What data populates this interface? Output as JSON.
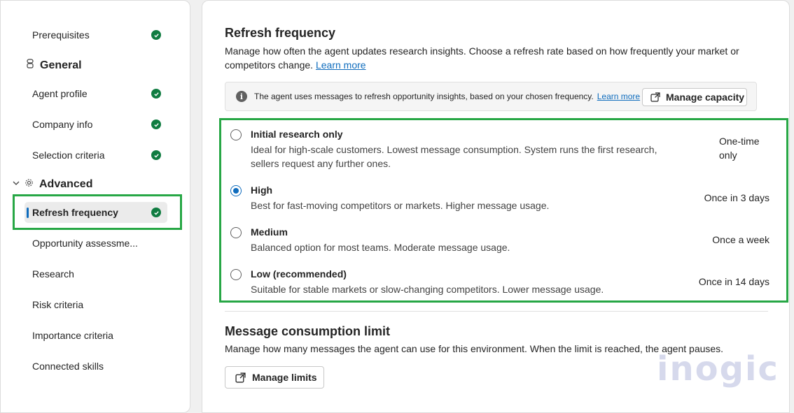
{
  "sidebar": {
    "items_top": [
      {
        "label": "Prerequisites",
        "done": true
      }
    ],
    "general": {
      "heading": "General",
      "items": [
        {
          "label": "Agent profile",
          "done": true
        },
        {
          "label": "Company info",
          "done": true
        },
        {
          "label": "Selection criteria",
          "done": true
        }
      ]
    },
    "advanced": {
      "heading": "Advanced",
      "items": [
        {
          "label": "Refresh frequency",
          "done": true,
          "active": true
        },
        {
          "label": "Opportunity assessme...",
          "done": false
        },
        {
          "label": "Research",
          "done": false
        },
        {
          "label": "Risk criteria",
          "done": false
        },
        {
          "label": "Importance criteria",
          "done": false
        },
        {
          "label": "Connected skills",
          "done": false
        }
      ]
    }
  },
  "refresh": {
    "title": "Refresh frequency",
    "description": "Manage how often the agent updates research insights. Choose a refresh rate based on how frequently your market or competitors change.",
    "learn_more": "Learn more",
    "info_text": "The agent uses messages to refresh opportunity insights, based on your chosen frequency.",
    "info_learn_more": "Learn more",
    "manage_capacity": "Manage capacity",
    "options": [
      {
        "title": "Initial research only",
        "desc": "Ideal for high-scale customers. Lowest message consumption. System runs the first research, sellers request any further ones.",
        "freq": "One-time only",
        "selected": false
      },
      {
        "title": "High",
        "desc": "Best for fast-moving competitors or markets. Higher message usage.",
        "freq": "Once in 3 days",
        "selected": true
      },
      {
        "title": "Medium",
        "desc": "Balanced option for most teams. Moderate message usage.",
        "freq": "Once a week",
        "selected": false
      },
      {
        "title": "Low (recommended)",
        "desc": "Suitable for stable markets or slow-changing competitors. Lower message usage.",
        "freq": "Once in 14 days",
        "selected": false
      }
    ]
  },
  "limit": {
    "title": "Message consumption limit",
    "description": "Manage how many messages the agent can use for this environment. When the limit is reached, the agent pauses.",
    "manage_limits": "Manage limits"
  },
  "watermark": "inogic",
  "colors": {
    "accent": "#0f6cbd",
    "success": "#107c41",
    "highlight": "#27a745"
  }
}
